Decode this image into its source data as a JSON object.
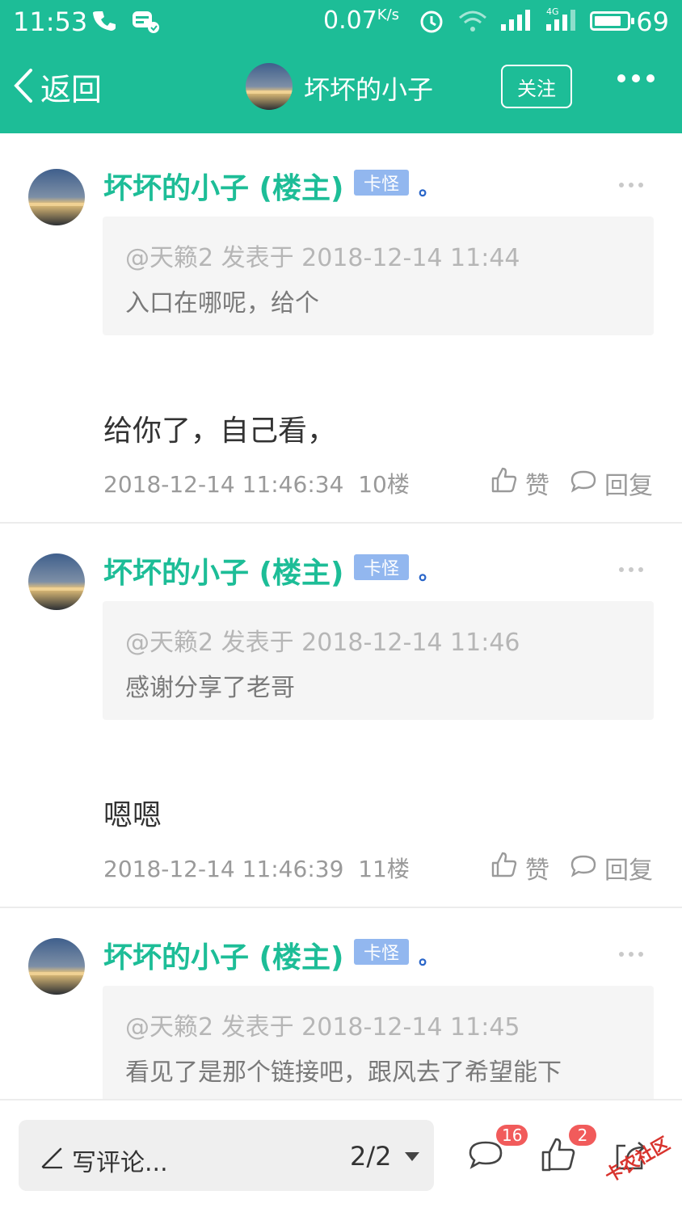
{
  "status_bar": {
    "time": "11:53",
    "speed": "0.07",
    "speed_unit": "K/s",
    "network": "4G",
    "battery": "69"
  },
  "nav": {
    "back_label": "返回",
    "title": "坏坏的小子",
    "follow_label": "关注"
  },
  "colors": {
    "brand": "#1dbd97",
    "badge": "#92b7ef",
    "count_badge": "#f15b5b"
  },
  "posts": [
    {
      "name": "坏坏的小子 (楼主)",
      "badge": "卡怪",
      "suffix": "。",
      "quote_header": "@天籁2 发表于 2018-12-14 11:44",
      "quote_text": "入口在哪呢，给个",
      "content": "给你了，自己看，",
      "timestamp": "2018-12-14 11:46:34",
      "floor": "10楼",
      "like_label": "赞",
      "reply_label": "回复"
    },
    {
      "name": "坏坏的小子 (楼主)",
      "badge": "卡怪",
      "suffix": "。",
      "quote_header": "@天籁2 发表于 2018-12-14 11:46",
      "quote_text": "感谢分享了老哥",
      "content": "嗯嗯",
      "timestamp": "2018-12-14 11:46:39",
      "floor": "11楼",
      "like_label": "赞",
      "reply_label": "回复"
    },
    {
      "name": "坏坏的小子 (楼主)",
      "badge": "卡怪",
      "suffix": "。",
      "quote_header": "@天籁2 发表于 2018-12-14 11:45",
      "quote_text": "看见了是那个链接吧，跟风去了希望能下"
    }
  ],
  "bottom_bar": {
    "compose_placeholder": "写评论...",
    "page_indicator": "2/2",
    "comment_count": "16",
    "like_count": "2",
    "watermark": "卡农社区"
  }
}
